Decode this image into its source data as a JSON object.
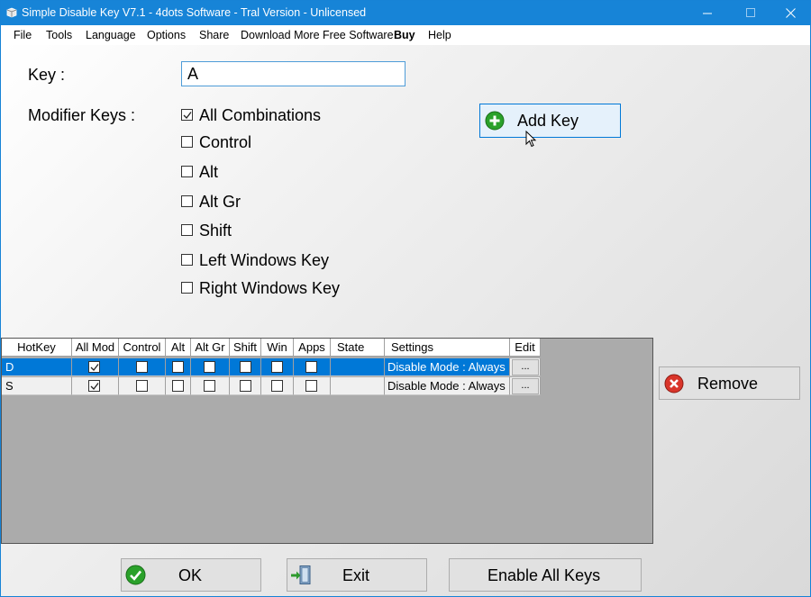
{
  "window": {
    "title": "Simple Disable Key V7.1 - 4dots Software - Tral Version - Unlicensed"
  },
  "menu": [
    {
      "label": "File"
    },
    {
      "label": "Tools"
    },
    {
      "label": "Language"
    },
    {
      "label": "Options"
    },
    {
      "label": "Share"
    },
    {
      "label": "Download More Free Software"
    },
    {
      "label": "Buy"
    },
    {
      "label": "Help"
    }
  ],
  "form": {
    "key_label": "Key :",
    "key_value": "A",
    "modifier_label": "Modifier Keys :",
    "modifiers": [
      {
        "label": "All Combinations",
        "checked": true
      },
      {
        "label": "Control",
        "checked": false
      },
      {
        "label": "Alt",
        "checked": false
      },
      {
        "label": "Alt Gr",
        "checked": false
      },
      {
        "label": "Shift",
        "checked": false
      },
      {
        "label": "Left Windows Key",
        "checked": false
      },
      {
        "label": "Right Windows Key",
        "checked": false
      }
    ],
    "add_key_label": "Add Key"
  },
  "table": {
    "columns": [
      "HotKey",
      "All Mod",
      "Control",
      "Alt",
      "Alt Gr",
      "Shift",
      "Win",
      "Apps",
      "State",
      "Settings",
      "Edit"
    ],
    "rows": [
      {
        "hotkey": "D",
        "all_mod": true,
        "control": false,
        "alt": false,
        "alt_gr": false,
        "shift": false,
        "win": false,
        "apps": false,
        "state": "",
        "settings": "Disable Mode : Always",
        "edit": "...",
        "selected": true
      },
      {
        "hotkey": "S",
        "all_mod": true,
        "control": false,
        "alt": false,
        "alt_gr": false,
        "shift": false,
        "win": false,
        "apps": false,
        "state": "",
        "settings": "Disable Mode : Always",
        "edit": "...",
        "selected": false
      }
    ]
  },
  "buttons": {
    "remove": "Remove",
    "ok": "OK",
    "exit": "Exit",
    "enable_all": "Enable All Keys"
  },
  "colors": {
    "titlebar": "#1784d7",
    "selection": "#0078d7",
    "ok_green": "#2aa12a",
    "remove_red": "#d9352a"
  }
}
